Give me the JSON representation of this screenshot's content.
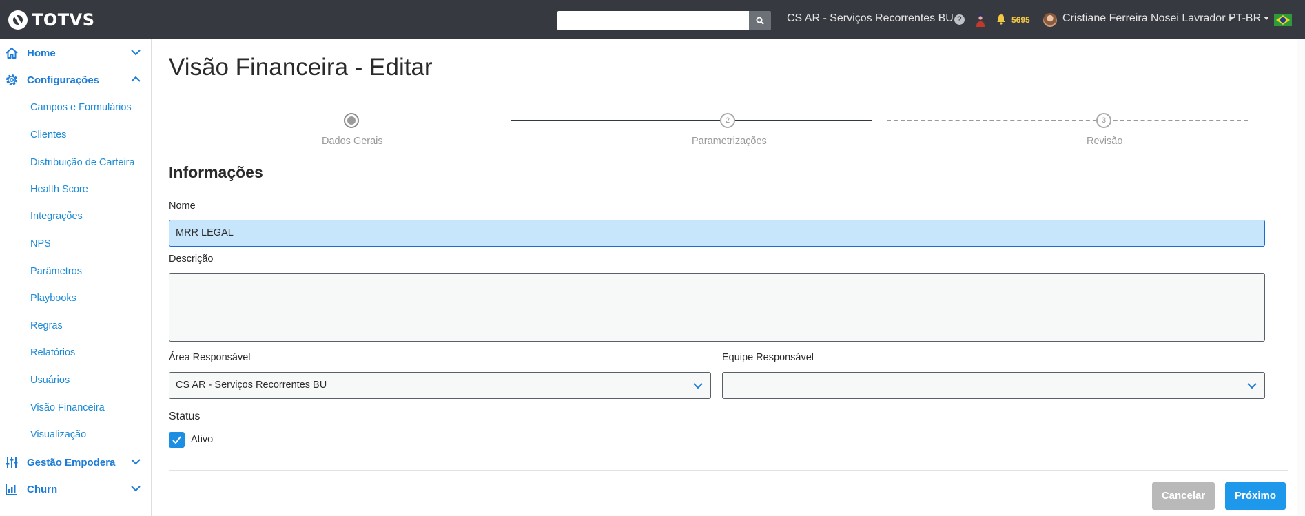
{
  "brand": {
    "name": "TOTVS"
  },
  "topbar": {
    "search_value": "",
    "org_selector": "CS AR - Serviços Recorrentes BU",
    "help_icon": "question-circle-icon",
    "notification_count": "5695",
    "user_name": "Cristiane Ferreira Nosei Lavrador",
    "language": "PT-BR",
    "colors": {
      "bar": "#363a40",
      "notification": "#f2c744"
    }
  },
  "sidebar": {
    "groups": [
      {
        "label": "Home",
        "icon": "home-icon",
        "expanded": false
      },
      {
        "label": "Configurações",
        "icon": "gear-icon",
        "expanded": true
      },
      {
        "label": "Gestão Empodera",
        "icon": "sliders-icon",
        "expanded": false
      },
      {
        "label": "Churn",
        "icon": "bar-chart-icon",
        "expanded": false
      }
    ],
    "config_items": [
      "Campos e Formulários",
      "Clientes",
      "Distribuição de Carteira",
      "Health Score",
      "Integrações",
      "NPS",
      "Parâmetros",
      "Playbooks",
      "Regras",
      "Relatórios",
      "Usuários",
      "Visão Financeira",
      "Visualização"
    ],
    "accent": "#1d7dd6"
  },
  "page": {
    "title": "Visão Financeira - Editar",
    "stepper": [
      {
        "number": "",
        "label": "Dados Gerais",
        "state": "current"
      },
      {
        "number": "2",
        "label": "Parametrizações",
        "state": "pending"
      },
      {
        "number": "3",
        "label": "Revisão",
        "state": "pending"
      }
    ],
    "section_title": "Informações",
    "form": {
      "nome_label": "Nome",
      "nome_value": "MRR LEGAL",
      "descricao_label": "Descrição",
      "descricao_value": "",
      "area_label": "Área Responsável",
      "area_value": "CS AR - Serviços Recorrentes BU",
      "equipe_label": "Equipe Responsável",
      "equipe_value": "",
      "status_label": "Status",
      "ativo_label": "Ativo",
      "ativo_checked": true
    },
    "buttons": {
      "cancel": "Cancelar",
      "next": "Próximo"
    },
    "colors": {
      "primary": "#1d98ea",
      "disabled": "#b9b9b9",
      "input_focus_bg": "#c7e6fb"
    }
  }
}
